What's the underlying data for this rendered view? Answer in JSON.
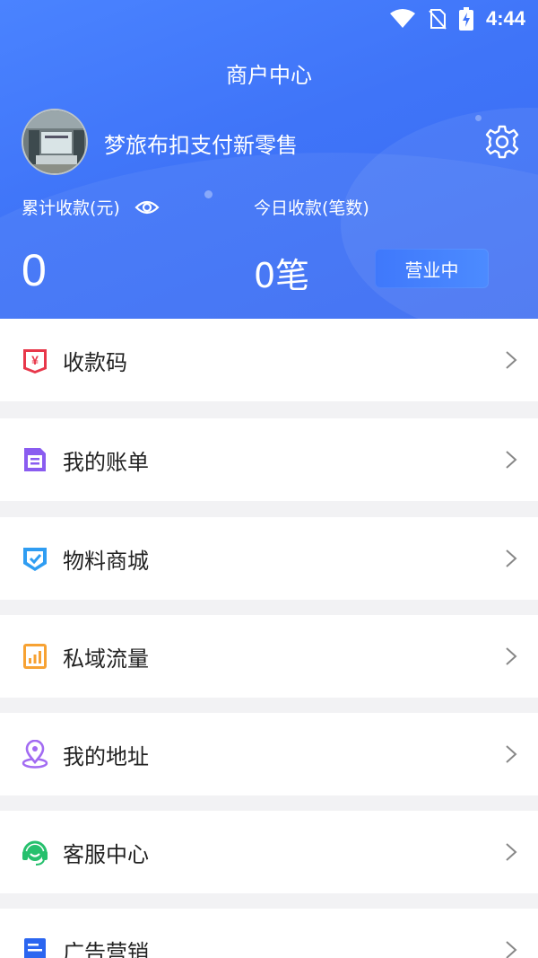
{
  "status_bar": {
    "time": "4:44"
  },
  "header": {
    "title": "商户中心",
    "shop_name": "梦旅布扣支付新零售",
    "total_label": "累计收款(元)",
    "today_label": "今日收款(笔数)",
    "total_value": "0",
    "today_value": "0笔",
    "status_button": "营业中"
  },
  "menu": [
    {
      "label": "收款码",
      "icon": "payment-code-icon",
      "color": "#e8374a"
    },
    {
      "label": "我的账单",
      "icon": "bill-icon",
      "color": "#8a5cf0"
    },
    {
      "label": "物料商城",
      "icon": "shield-check-icon",
      "color": "#2f9df2"
    },
    {
      "label": "私域流量",
      "icon": "chart-icon",
      "color": "#f7a233"
    },
    {
      "label": "我的地址",
      "icon": "location-icon",
      "color": "#a26bf2"
    },
    {
      "label": "客服中心",
      "icon": "headset-icon",
      "color": "#26c06d"
    },
    {
      "label": "广告营销",
      "icon": "ad-icon",
      "color": "#2b66f0"
    }
  ]
}
